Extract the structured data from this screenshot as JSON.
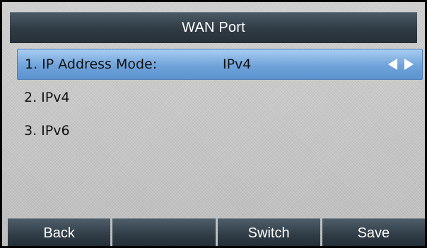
{
  "header": {
    "title": "WAN Port"
  },
  "menu": {
    "items": [
      {
        "label": "1. IP Address Mode:",
        "value": "IPv4",
        "selected": true
      },
      {
        "label": "2. IPv4"
      },
      {
        "label": "3. IPv6"
      }
    ]
  },
  "softkeys": {
    "back": "Back",
    "empty": "",
    "switch": "Switch",
    "save": "Save"
  },
  "colors": {
    "selection": "#6fa3da",
    "titlebar": "#2f3a43",
    "background": "#c9c9c9"
  }
}
